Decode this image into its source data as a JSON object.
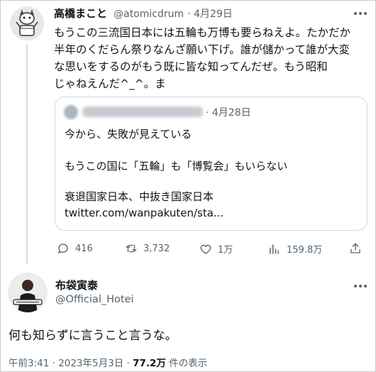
{
  "tweet": {
    "author_name": "高橋まこと",
    "handle": "@atomicdrum",
    "date": "4月29日",
    "text_lines": [
      "もうこの三流国日本には五輪も万博も要らねえよ。たかだか",
      "半年のくだらん祭りなんざ願い下げ。誰が儲かって誰が大変",
      "な思いをするのがもう既に皆な知ってんだぜ。もう昭和",
      "じゃねえんだ^_^。ま"
    ],
    "quote": {
      "date": "· 4月28日",
      "lines": [
        "今から、失敗が見えている",
        "もうこの国に「五輪」も「博覧会」もいらない",
        "衰退国家日本、中抜き国家日本",
        "twitter.com/wanpakuten/sta..."
      ]
    },
    "actions": {
      "reply": "416",
      "retweet": "3,732",
      "like": "1万",
      "views": "159.8万"
    }
  },
  "reply": {
    "author_name": "布袋寅泰",
    "handle": "@Official_Hotei",
    "text": "何も知らずに言うこと言うな。",
    "timestamp": "午前3:41 · 2023年5月3日 · ",
    "views_count": "77.2万",
    "views_label": " 件の表示"
  }
}
